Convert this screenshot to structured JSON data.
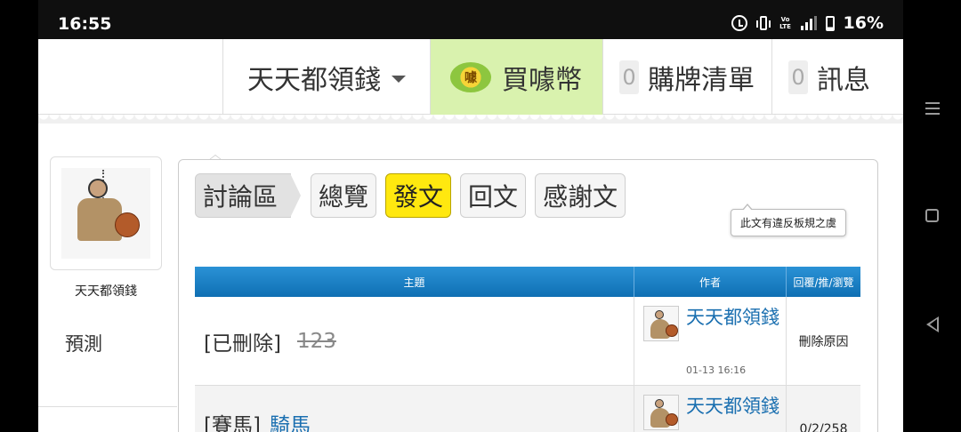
{
  "status_bar": {
    "time": "16:55",
    "volte": "Vo LTE",
    "battery": "16%"
  },
  "topnav": {
    "user_menu": "天天都領錢",
    "buy_coin": "買噱幣",
    "coin_label": "噱",
    "cart_count": "0",
    "cart_label": "購牌清單",
    "msg_count": "0",
    "msg_label": "訊息"
  },
  "profile": {
    "name": "天天都領錢",
    "side_item": "預測"
  },
  "board": {
    "breadcrumb": "討論區",
    "buttons": [
      "總覽",
      "發文",
      "回文",
      "感謝文"
    ],
    "table_headers": [
      "主題",
      "作者",
      "回覆/推/瀏覽"
    ],
    "rows": [
      {
        "prefix": "[已刪除]",
        "title": "123",
        "author": "天天都領錢",
        "time": "01-13 16:16",
        "stat": "刪除原因"
      },
      {
        "prefix": "[賽馬]",
        "title": "騎馬",
        "author": "天天都領錢",
        "time": "",
        "stat": "0/2/258"
      }
    ],
    "tooltip": "此文有違反板規之虞"
  }
}
